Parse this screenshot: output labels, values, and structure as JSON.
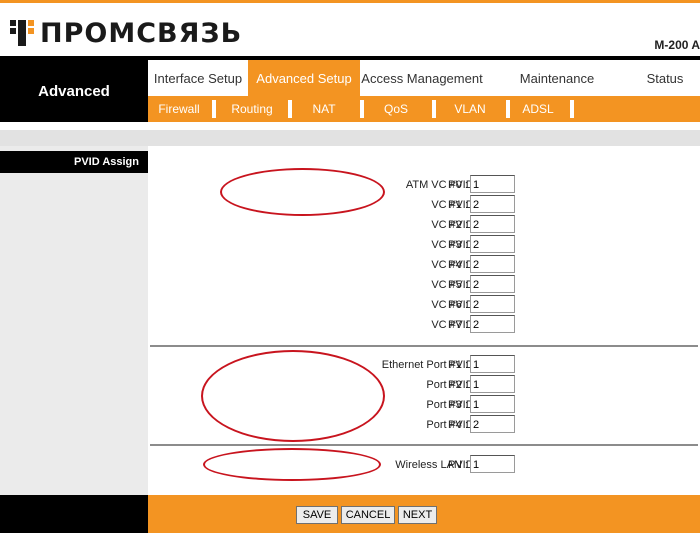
{
  "header": {
    "logo_text": "ПРОМСВЯЗЬ",
    "model": "M-200 A"
  },
  "section_title": "Advanced",
  "main_tabs": [
    {
      "label": "Interface Setup",
      "active": false
    },
    {
      "label": "Advanced Setup",
      "active": true
    },
    {
      "label": "Access Management",
      "active": false
    },
    {
      "label": "Maintenance",
      "active": false
    },
    {
      "label": "Status",
      "active": false
    }
  ],
  "sub_tabs": [
    "Firewall",
    "Routing",
    "NAT",
    "QoS",
    "VLAN",
    "ADSL"
  ],
  "panel_label": "PVID Assign",
  "pvid_label": "PVID",
  "atm_rows": [
    {
      "label": "ATM VC #0 :",
      "value": "1"
    },
    {
      "label": "VC #1 :",
      "value": "2"
    },
    {
      "label": "VC #2 :",
      "value": "2"
    },
    {
      "label": "VC #3 :",
      "value": "2"
    },
    {
      "label": "VC #4 :",
      "value": "2"
    },
    {
      "label": "VC #5 :",
      "value": "2"
    },
    {
      "label": "VC #6 :",
      "value": "2"
    },
    {
      "label": "VC #7 :",
      "value": "2"
    }
  ],
  "ethernet_rows": [
    {
      "label": "Ethernet Port #1 :",
      "value": "1"
    },
    {
      "label": "Port #2 :",
      "value": "1"
    },
    {
      "label": "Port #3 :",
      "value": "1"
    },
    {
      "label": "Port #4 :",
      "value": "2"
    }
  ],
  "wireless_rows": [
    {
      "label": "Wireless LAN :",
      "value": "1"
    }
  ],
  "buttons": {
    "save": "SAVE",
    "cancel": "CANCEL",
    "next": "NEXT"
  },
  "colors": {
    "accent": "#f39422",
    "annotation": "#c8141e"
  }
}
